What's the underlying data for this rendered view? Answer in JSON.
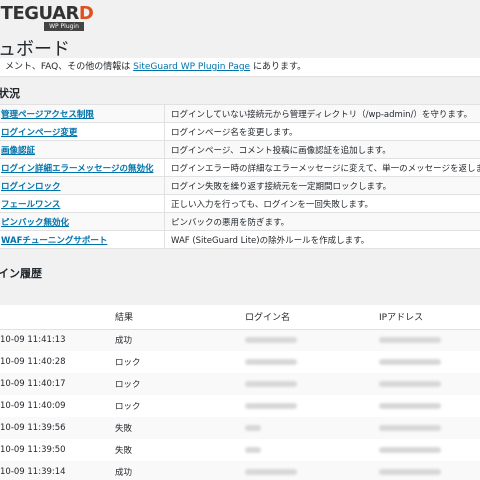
{
  "logo": {
    "brand_main": "SITEGUAR",
    "brand_last": "D",
    "sub": "WP Plugin"
  },
  "page_title": "ュボード",
  "info_bar": {
    "text_before": "メント、FAQ、その他の情報は ",
    "link": "SiteGuard WP Plugin Page",
    "text_after": " にあります。"
  },
  "status": {
    "title": "状況",
    "rows": [
      {
        "feature": "管理ページアクセス制限",
        "desc": "ログインしていない接続元から管理ディレクトリ（/wp-admin/）を守ります。"
      },
      {
        "feature": "ログインページ変更",
        "desc": "ログインページ名を変更します。"
      },
      {
        "feature": "画像認証",
        "desc": "ログインページ、コメント投稿に画像認証を追加します。"
      },
      {
        "feature": "ログイン詳細エラーメッセージの無効化",
        "desc": "ログインエラー時の詳細なエラーメッセージに変えて、単一のメッセージを返します"
      },
      {
        "feature": "ログインロック",
        "desc": "ログイン失敗を繰り返す接続元を一定期間ロックします。"
      },
      {
        "feature": "フェールワンス",
        "desc": "正しい入力を行っても、ログインを一回失敗します。"
      },
      {
        "feature": "ピンバック無効化",
        "desc": "ピンバックの悪用を防ぎます。"
      },
      {
        "feature": "WAFチューニングサポート",
        "desc": "WAF (SiteGuard Lite)の除外ルールを作成します。"
      }
    ]
  },
  "history": {
    "title": "イン履歴",
    "columns": {
      "date": "",
      "result": "結果",
      "login": "ログイン名",
      "ip": "IPアドレス"
    },
    "rows": [
      {
        "date": "10-09 11:41:13",
        "result": "成功"
      },
      {
        "date": "10-09 11:40:28",
        "result": "ロック"
      },
      {
        "date": "10-09 11:40:17",
        "result": "ロック"
      },
      {
        "date": "10-09 11:40:09",
        "result": "ロック"
      },
      {
        "date": "10-09 11:39:56",
        "result": "失敗"
      },
      {
        "date": "10-09 11:39:50",
        "result": "失敗"
      },
      {
        "date": "10-09 11:39:14",
        "result": "成功"
      }
    ]
  },
  "colors": {
    "link": "#0073aa",
    "logo_accent": "#e0501e",
    "info_border": "#5b9dd9"
  }
}
